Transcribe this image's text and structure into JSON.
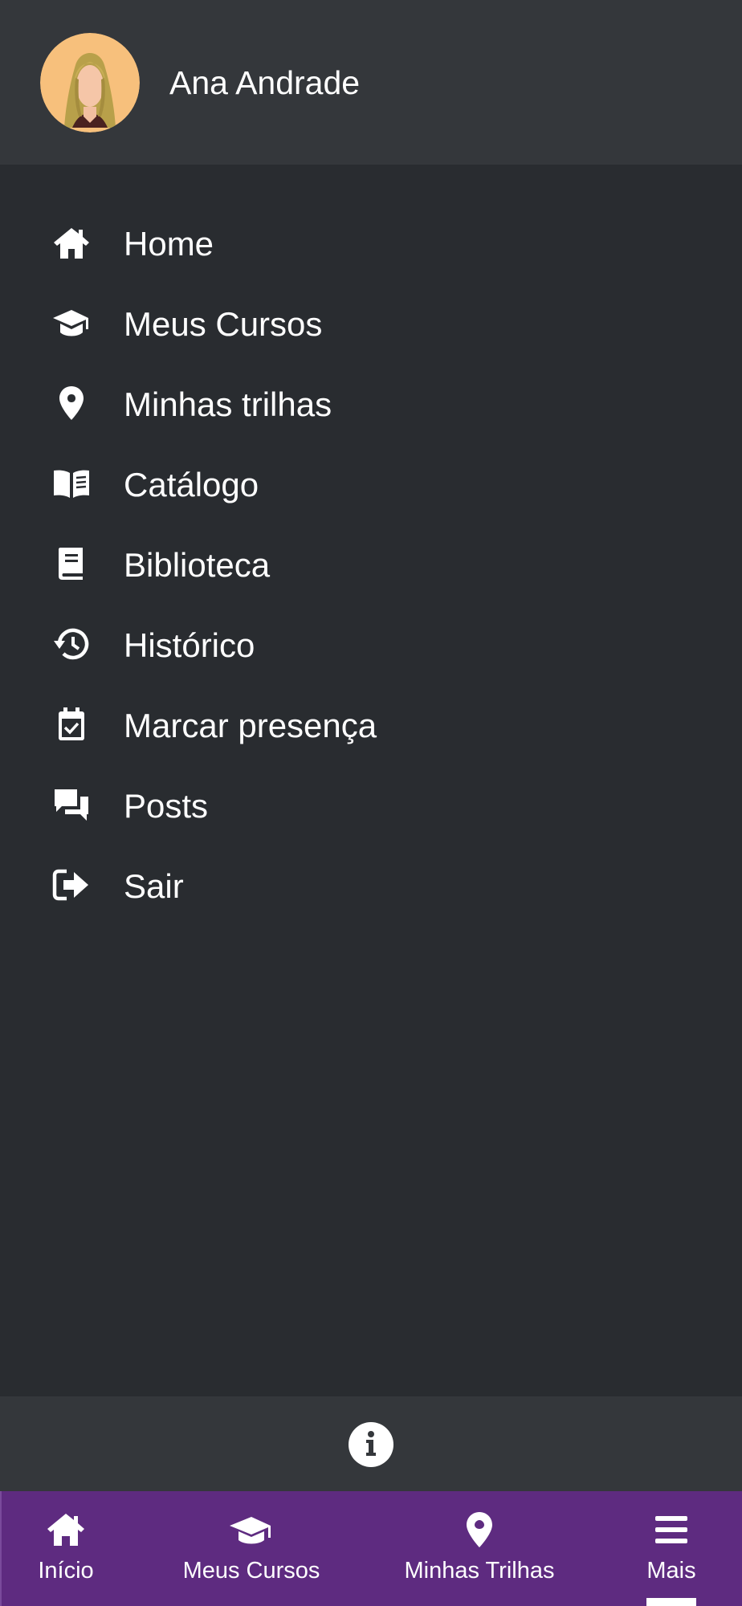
{
  "user": {
    "name": "Ana Andrade",
    "avatar_icon": "user-avatar-woman"
  },
  "menu": {
    "items": [
      {
        "label": "Home",
        "icon": "home-icon"
      },
      {
        "label": "Meus Cursos",
        "icon": "graduation-cap-icon"
      },
      {
        "label": "Minhas trilhas",
        "icon": "map-pin-icon"
      },
      {
        "label": "Catálogo",
        "icon": "open-book-icon"
      },
      {
        "label": "Biblioteca",
        "icon": "book-icon"
      },
      {
        "label": "Histórico",
        "icon": "history-icon"
      },
      {
        "label": "Marcar presença",
        "icon": "calendar-check-icon"
      },
      {
        "label": "Posts",
        "icon": "comments-icon"
      },
      {
        "label": "Sair",
        "icon": "sign-out-icon"
      }
    ]
  },
  "info": {
    "icon": "info-icon"
  },
  "bottom_nav": {
    "tabs": [
      {
        "label": "Início",
        "icon": "home-icon"
      },
      {
        "label": "Meus Cursos",
        "icon": "graduation-cap-icon"
      },
      {
        "label": "Minhas Trilhas",
        "icon": "map-pin-icon"
      },
      {
        "label": "Mais",
        "icon": "menu-icon",
        "active": true
      }
    ]
  },
  "colors": {
    "drawer_background": "#292c30",
    "header_background": "#34373b",
    "bottom_nav_background": "#5e2b80",
    "text": "#ffffff"
  }
}
